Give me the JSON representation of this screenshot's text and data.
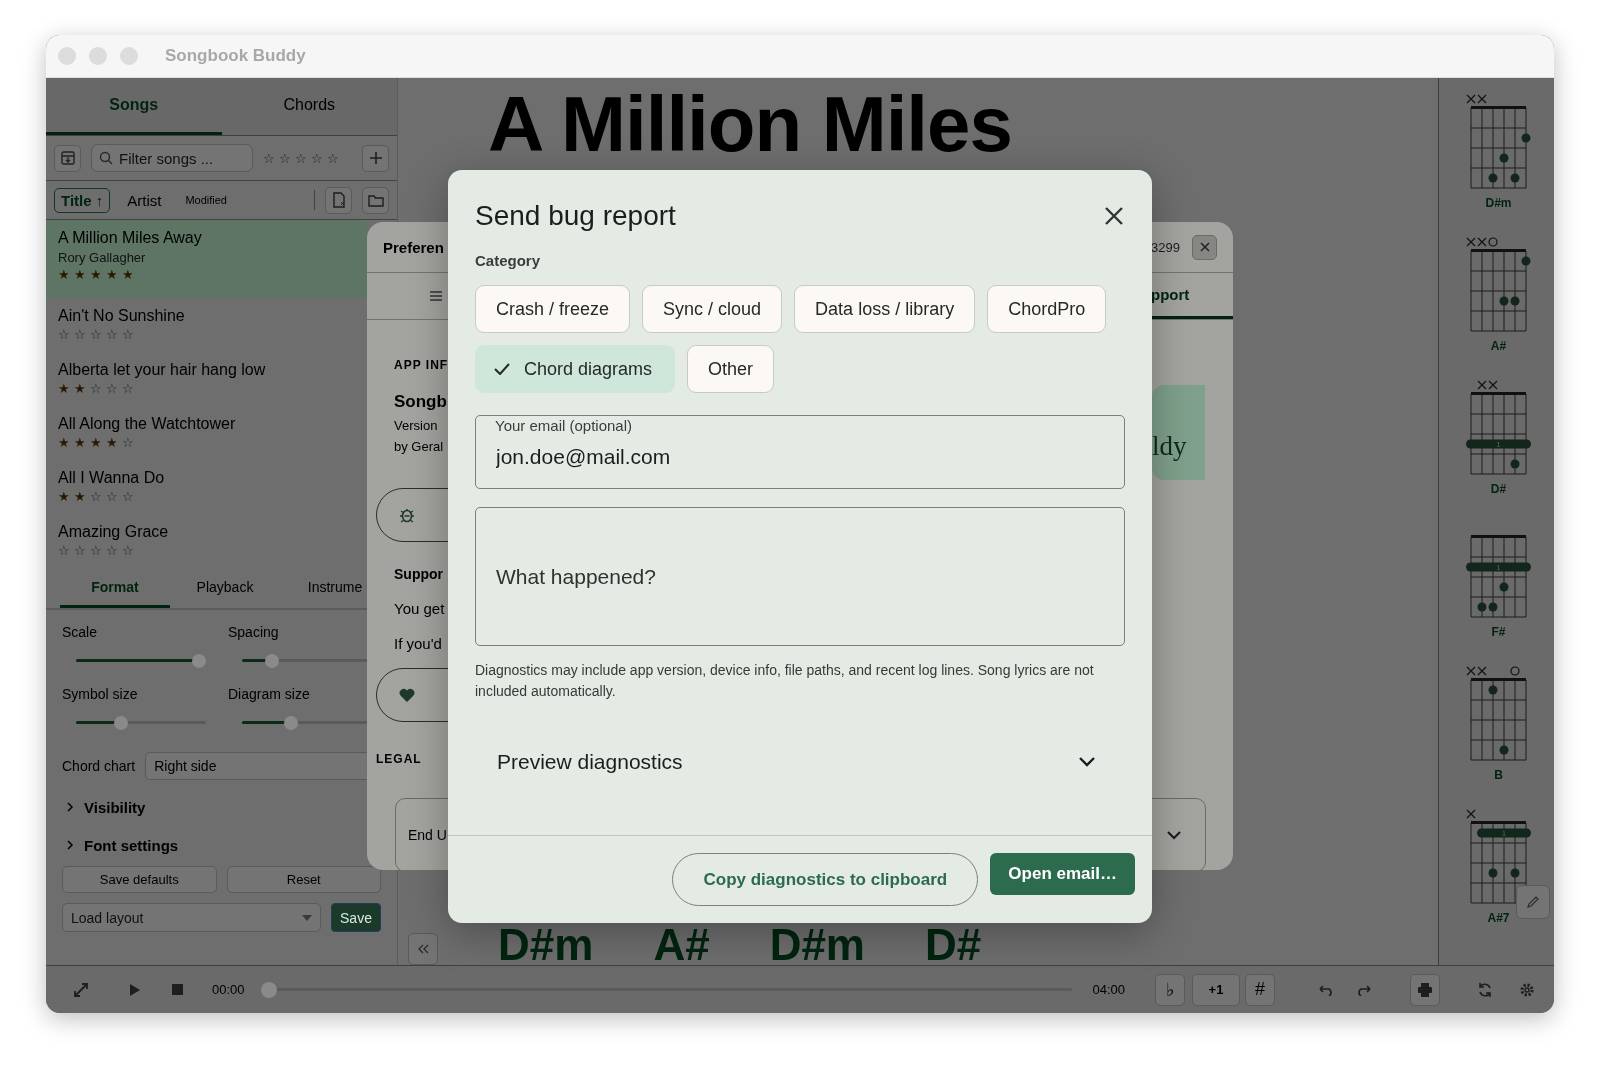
{
  "window": {
    "title": "Songbook Buddy"
  },
  "sidebar": {
    "tabs": [
      {
        "label": "Songs",
        "selected": true
      },
      {
        "label": "Chords",
        "selected": false
      }
    ],
    "filter": {
      "placeholder": "Filter songs ...",
      "stars": 0
    },
    "sort": [
      {
        "label": "Title ↑",
        "selected": true
      },
      {
        "label": "Artist",
        "selected": false
      },
      {
        "label": "Modified",
        "selected": false
      }
    ],
    "songs": [
      {
        "title": "A Million Miles Away",
        "artist": "Rory Gallagher",
        "stars": 5,
        "selected": true
      },
      {
        "title": "Ain't No Sunshine",
        "stars": 0,
        "selected": false
      },
      {
        "title": "Alberta let your hair hang low",
        "stars": 2,
        "selected": false
      },
      {
        "title": "All Along the Watchtower",
        "stars": 4,
        "selected": false
      },
      {
        "title": "All I Wanna Do",
        "stars": 2,
        "selected": false
      },
      {
        "title": "Amazing Grace",
        "stars": 0,
        "selected": false
      }
    ],
    "settings_tabs": [
      {
        "label": "Format",
        "selected": true
      },
      {
        "label": "Playback",
        "selected": false
      },
      {
        "label": "Instrume",
        "selected": false
      }
    ],
    "sliders": [
      {
        "label": "Scale",
        "level": 1
      },
      {
        "label": "Spacing",
        "level": 0.2
      },
      {
        "label": "Symbol size",
        "level": 0.33
      },
      {
        "label": "Diagram size",
        "level": 0.36
      }
    ],
    "chord_chart": {
      "label": "Chord chart",
      "value": "Right side"
    },
    "sections": [
      {
        "label": "Visibility",
        "expanded": false
      },
      {
        "label": "Font settings",
        "expanded": false
      }
    ],
    "buttons": [
      "Save defaults",
      "Reset"
    ],
    "layout": {
      "placeholder": "Load layout",
      "save": "Save"
    }
  },
  "song": {
    "title": "A Million Miles",
    "chords": [
      "D#m",
      "A#",
      "D#m",
      "D#"
    ]
  },
  "chord_panel": [
    {
      "name": "D#m"
    },
    {
      "name": "A#"
    },
    {
      "name": "D#",
      "barre_label": "1"
    },
    {
      "name": "F#",
      "barre_label": "1"
    },
    {
      "name": "B"
    },
    {
      "name": "A#7",
      "barre_label": "1"
    }
  ],
  "transport": {
    "elapsed": "00:00",
    "total": "04:00",
    "level": 0
  },
  "transpose": {
    "flat": "♭",
    "step": "+1",
    "sharp": "#"
  },
  "preferences": {
    "title": "Preferen",
    "id": "3299",
    "tab": {
      "label": "pport",
      "selected": true
    },
    "app_heading": "APP INF",
    "app_name": "Songb",
    "version": "Version",
    "author": "by Geral",
    "logo": "ldy",
    "support_heading": "Suppor",
    "support_lines": [
      "You get",
      "If you'd"
    ],
    "legal_heading": "LEGAL",
    "legal_select": "End U"
  },
  "dialog": {
    "title": "Send bug report",
    "category_label": "Category",
    "categories": [
      {
        "label": "Crash / freeze",
        "selected": false
      },
      {
        "label": "Sync / cloud",
        "selected": false
      },
      {
        "label": "Data loss / library",
        "selected": false
      },
      {
        "label": "ChordPro",
        "selected": false
      },
      {
        "label": "Chord diagrams",
        "selected": true
      },
      {
        "label": "Other",
        "selected": false
      }
    ],
    "email": {
      "label": "Your email (optional)",
      "value": "jon.doe@mail.com"
    },
    "details": {
      "placeholder": "What happened?"
    },
    "note": "Diagnostics may include app version, device info, file paths, and recent log lines. Song lyrics are not included automatically.",
    "preview": {
      "label": "Preview diagnostics",
      "expanded": false
    },
    "actions": [
      {
        "label": "Copy diagnostics to clipboard",
        "kind": "secondary"
      },
      {
        "label": "Open email…",
        "kind": "primary"
      }
    ]
  }
}
